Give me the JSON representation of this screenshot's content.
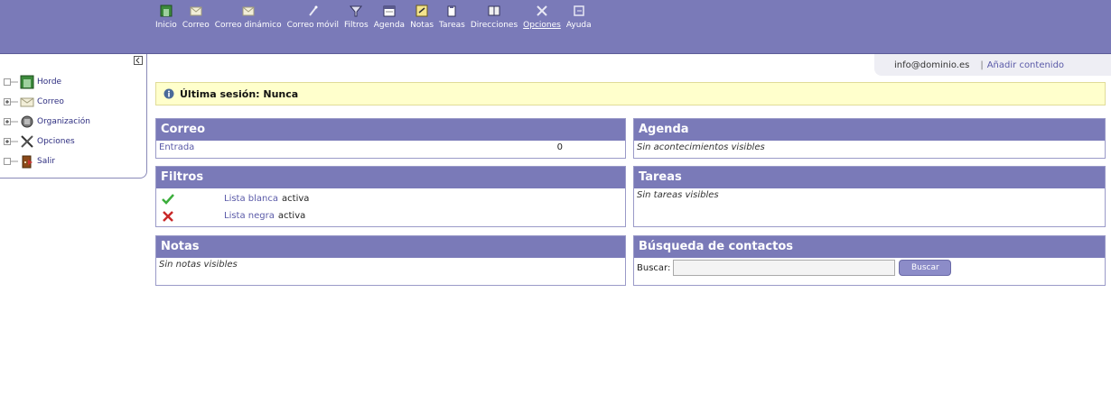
{
  "nav": {
    "items": [
      {
        "label": "Inicio",
        "icon": "home-icon"
      },
      {
        "label": "Correo",
        "icon": "mail-icon"
      },
      {
        "label": "Correo dinámico",
        "icon": "dynamic-mail-icon"
      },
      {
        "label": "Correo móvil",
        "icon": "mobile-mail-icon"
      },
      {
        "label": "Filtros",
        "icon": "filter-icon"
      },
      {
        "label": "Agenda",
        "icon": "calendar-icon"
      },
      {
        "label": "Notas",
        "icon": "notes-icon"
      },
      {
        "label": "Tareas",
        "icon": "tasks-icon"
      },
      {
        "label": "Direcciones",
        "icon": "address-book-icon"
      },
      {
        "label": "Opciones",
        "icon": "options-icon"
      },
      {
        "label": "Ayuda",
        "icon": "help-icon"
      }
    ]
  },
  "sidebar": {
    "items": [
      {
        "label": "Horde",
        "icon": "horde-icon"
      },
      {
        "label": "Correo",
        "icon": "mail-icon"
      },
      {
        "label": "Organización",
        "icon": "organization-icon"
      },
      {
        "label": "Opciones",
        "icon": "options-icon"
      },
      {
        "label": "Salir",
        "icon": "logout-icon"
      }
    ]
  },
  "userbar": {
    "email": "info@dominio.es",
    "separator": "|",
    "add_content": "Añadir contenido"
  },
  "session": {
    "text": "Última sesión: Nunca"
  },
  "panels": {
    "correo": {
      "title": "Correo",
      "inbox_label": "Entrada",
      "inbox_count": "0"
    },
    "agenda": {
      "title": "Agenda",
      "empty": "Sin acontecimientos visibles"
    },
    "filtros": {
      "title": "Filtros",
      "whitelist_link": "Lista blanca",
      "whitelist_status": "activa",
      "blacklist_link": "Lista negra",
      "blacklist_status": "activa"
    },
    "tareas": {
      "title": "Tareas",
      "empty": "Sin tareas visibles"
    },
    "notas": {
      "title": "Notas",
      "empty": "Sin notas visibles"
    },
    "busqueda": {
      "title": "Búsqueda de contactos",
      "search_label": "Buscar:",
      "search_value": "",
      "search_button": "Buscar"
    }
  },
  "colors": {
    "header_bg": "#7a7ab8",
    "session_bg": "#ffffcc",
    "link": "#5a5aa8"
  }
}
